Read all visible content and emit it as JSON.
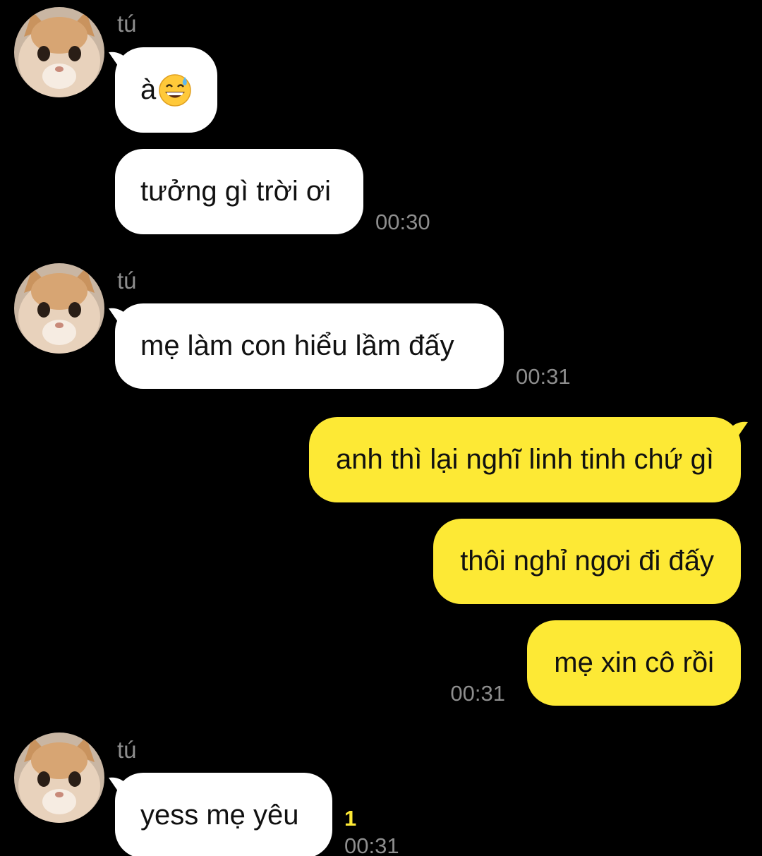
{
  "messages": [
    {
      "sender": "tú",
      "bubbles": [
        {
          "text": "à",
          "emoji": "grinning-sweat-emoji"
        },
        {
          "text": "tưởng gì trời ơi",
          "time": "00:30"
        }
      ]
    },
    {
      "sender": "tú",
      "bubbles": [
        {
          "text": "mẹ làm con hiểu lầm đấy",
          "time": "00:31"
        }
      ]
    },
    {
      "sender": "me",
      "bubbles": [
        {
          "text": "anh thì lại nghĩ linh tinh chứ gì"
        },
        {
          "text": "thôi nghỉ ngơi đi đấy"
        },
        {
          "text": "mẹ xin cô rồi",
          "time": "00:31"
        }
      ]
    },
    {
      "sender": "tú",
      "bubbles": [
        {
          "text": "yess mẹ yêu",
          "unread": "1",
          "time": "00:31"
        }
      ]
    }
  ],
  "colors": {
    "background": "#000000",
    "incoming_bubble": "#ffffff",
    "outgoing_bubble": "#fde935",
    "meta_text": "#8e8e8e",
    "unread_count": "#fde935"
  },
  "icons": {
    "avatar": "cat-face-avatar",
    "bubble_tail": "speech-tail"
  }
}
